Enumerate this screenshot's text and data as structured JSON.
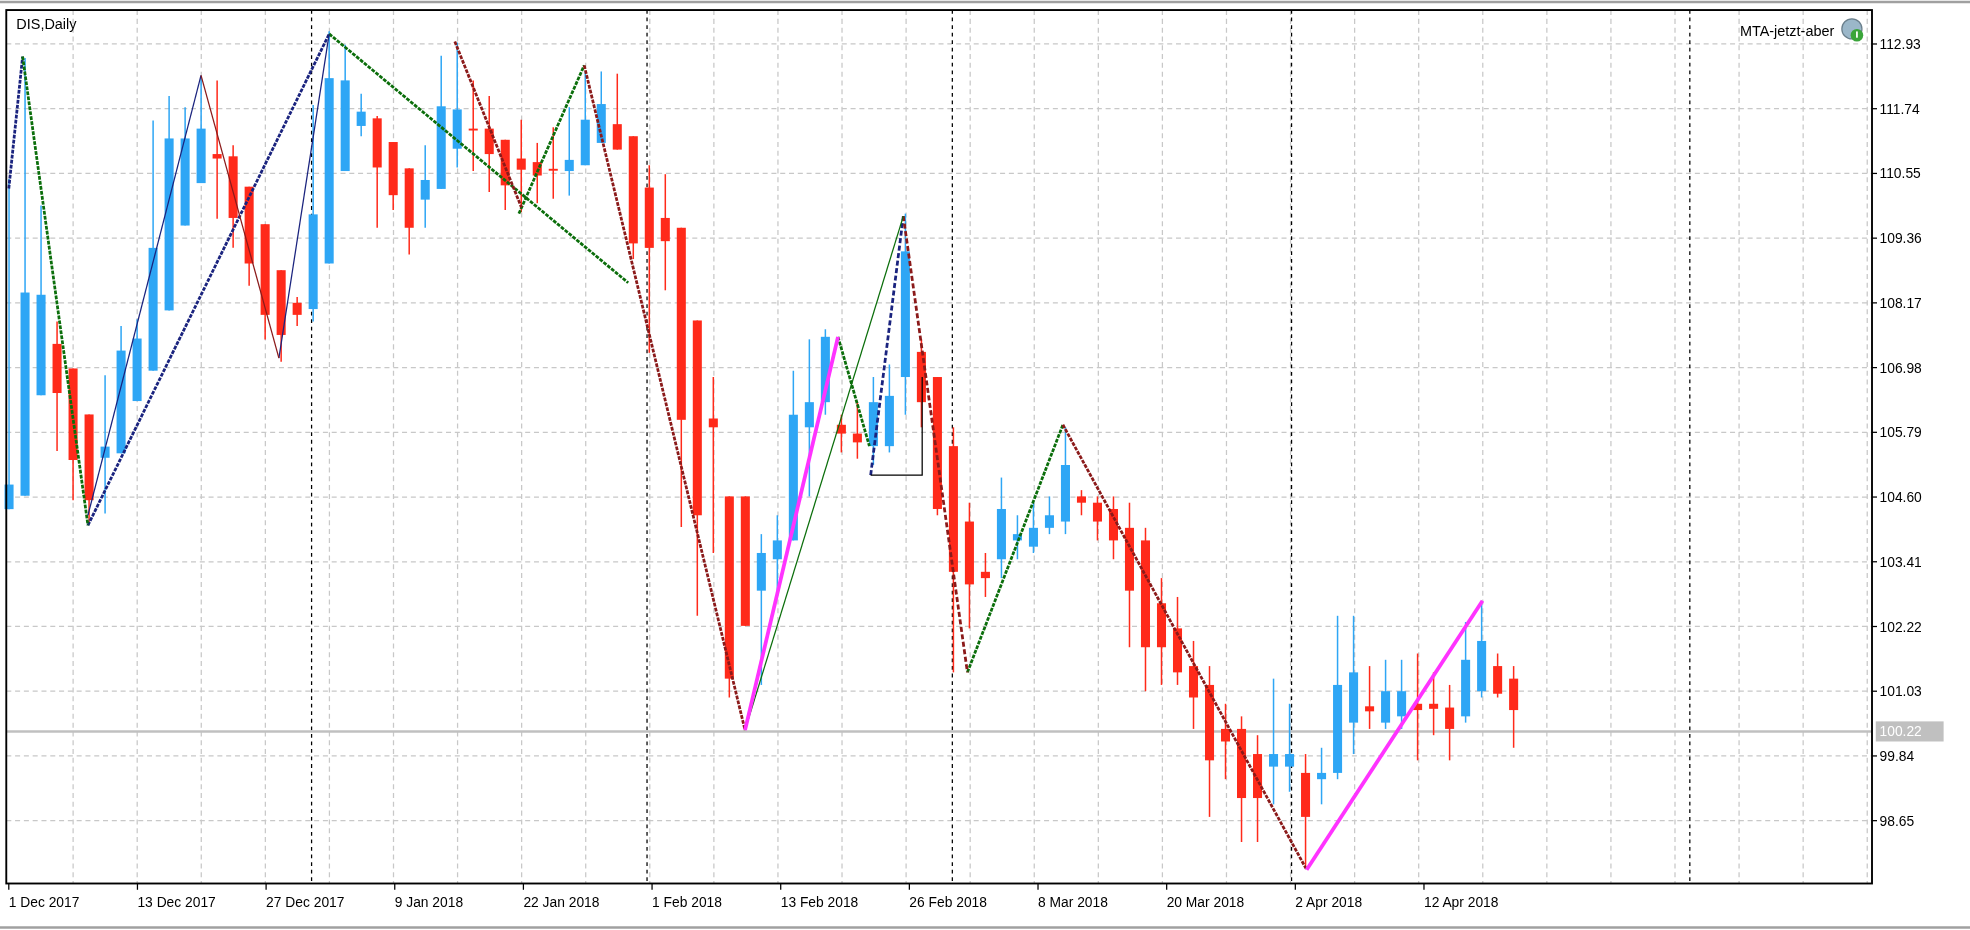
{
  "chart": {
    "symbol_label": "DIS,Daily",
    "indicator": {
      "label": "MTA-jetzt-aber"
    },
    "price_axis": {
      "labels": [
        "112.93",
        "111.74",
        "110.55",
        "109.36",
        "108.17",
        "106.98",
        "105.79",
        "104.60",
        "103.41",
        "102.22",
        "101.03",
        "99.84",
        "98.65"
      ]
    },
    "current_price": {
      "label": "100.22"
    },
    "time_axis": {
      "labels": [
        "1 Dec 2017",
        "13 Dec 2017",
        "27 Dec 2017",
        "9 Jan 2018",
        "22 Jan 2018",
        "1 Feb 2018",
        "13 Feb 2018",
        "26 Feb 2018",
        "8 Mar 2018",
        "20 Mar 2018",
        "2 Apr 2018",
        "12 Apr 2018"
      ]
    }
  }
}
